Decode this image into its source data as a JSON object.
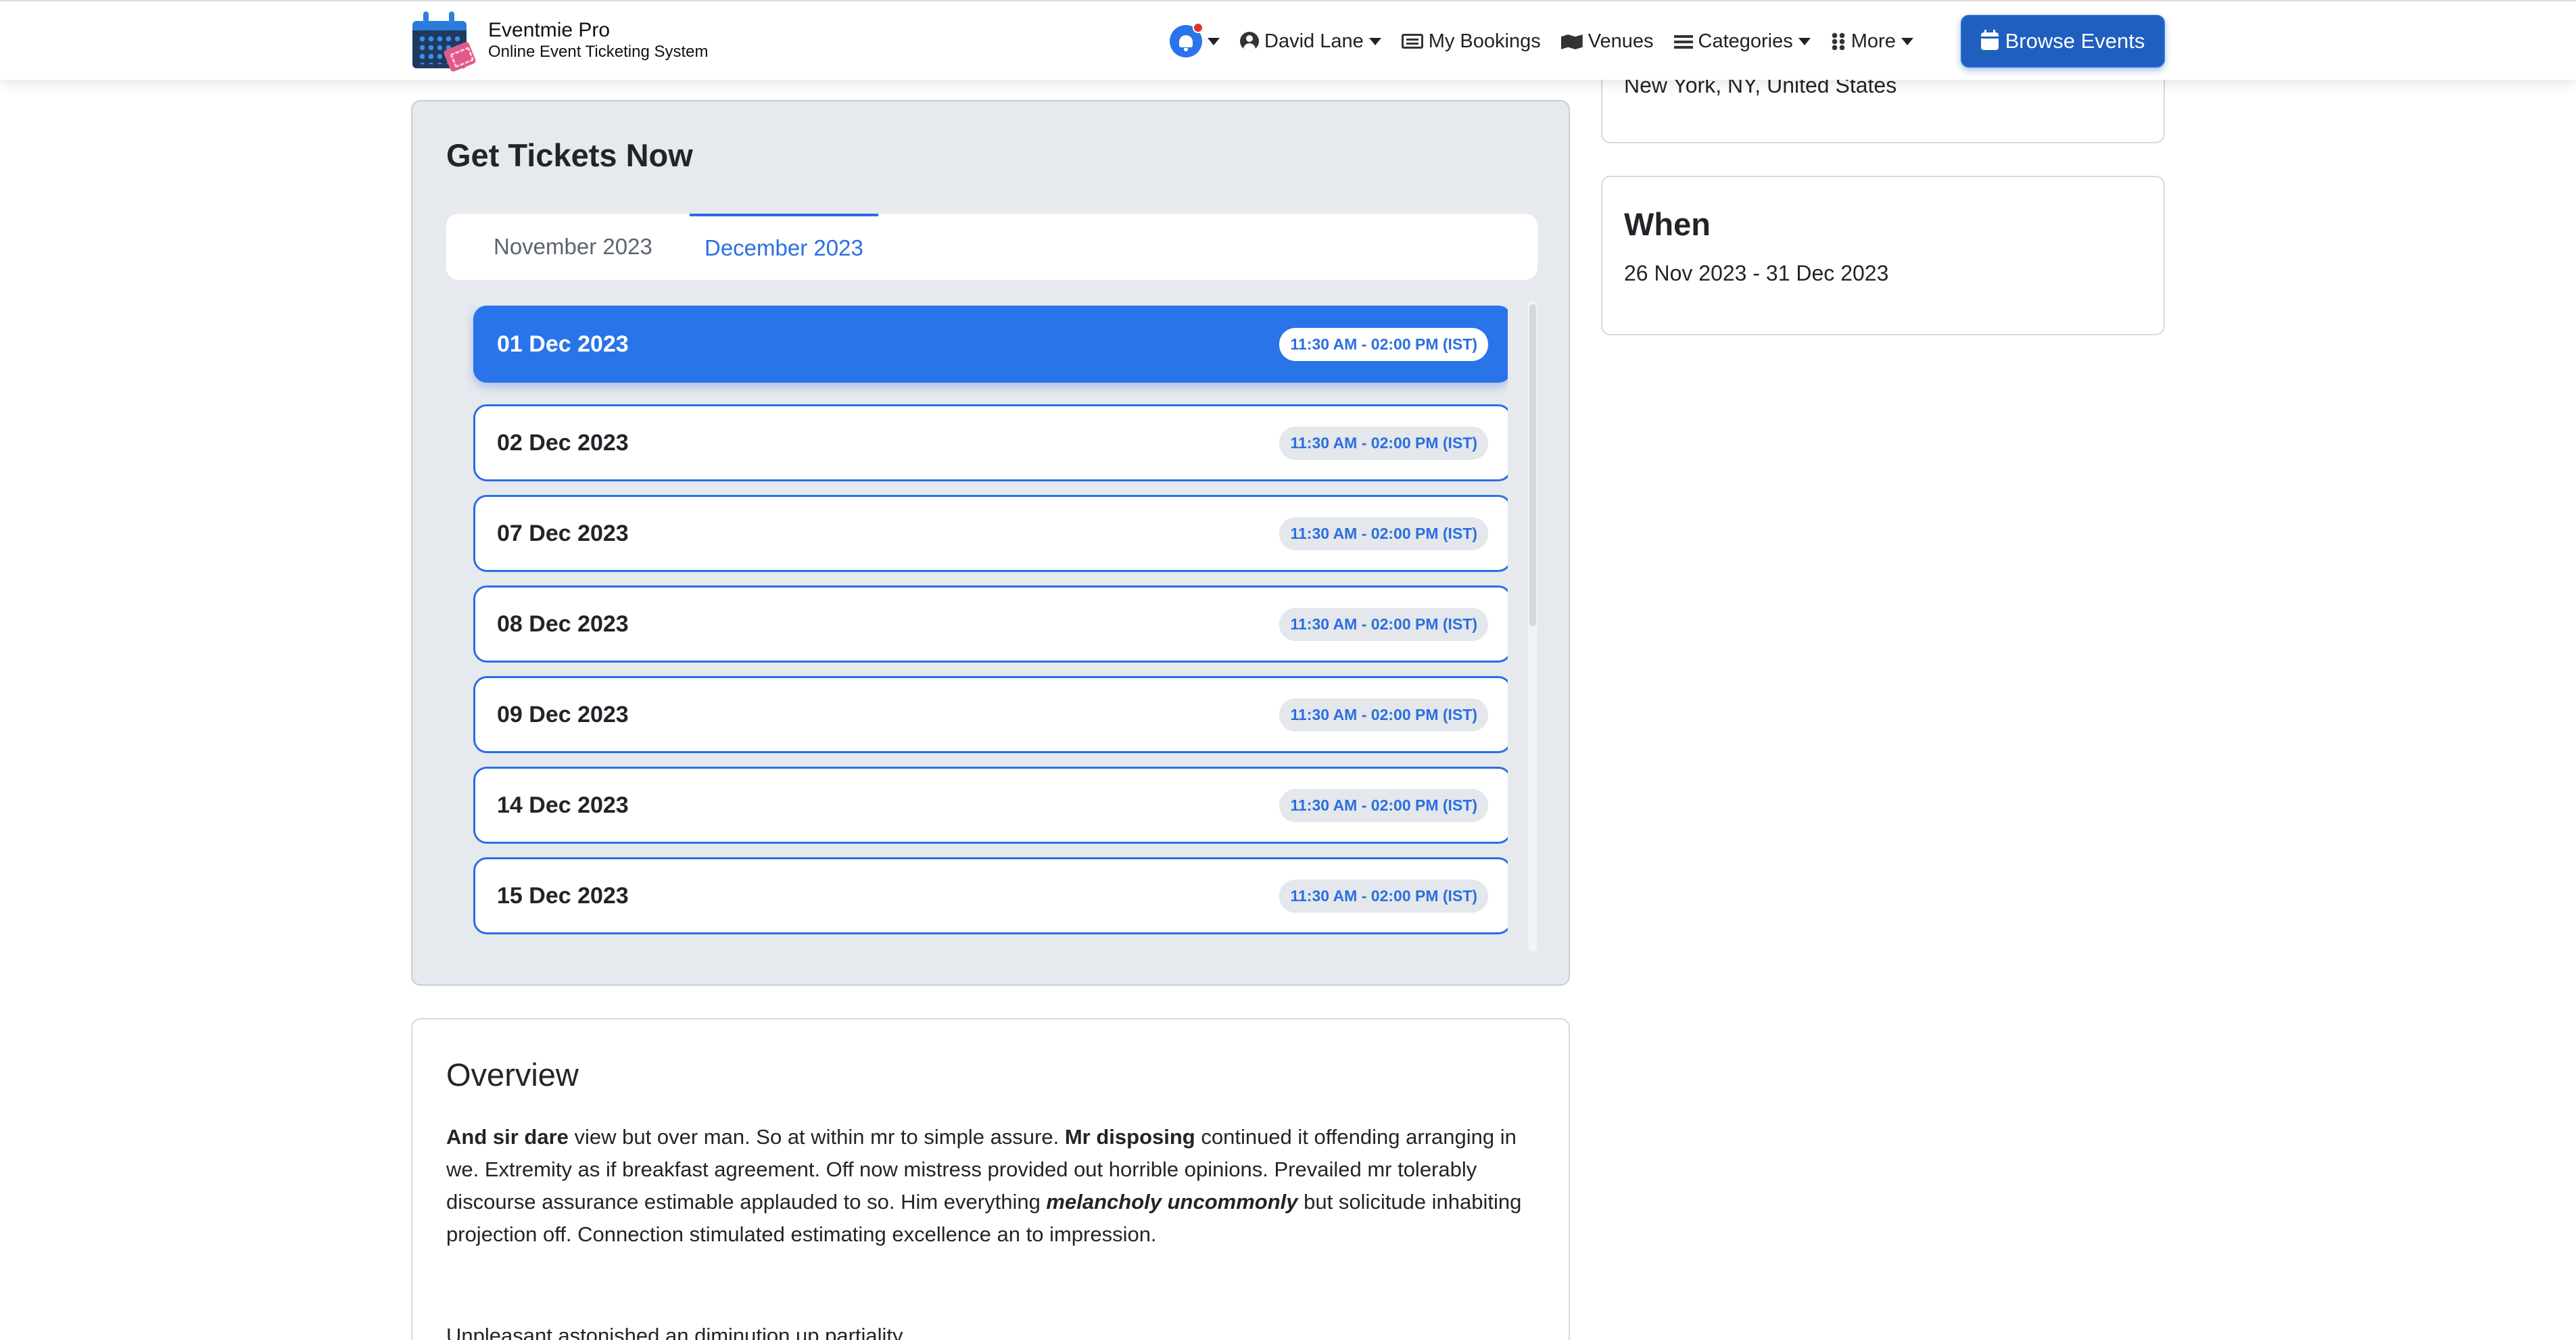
{
  "brand": {
    "name": "Eventmie Pro",
    "tagline": "Online Event Ticketing System"
  },
  "nav": {
    "user_name": "David Lane",
    "my_bookings": "My Bookings",
    "venues": "Venues",
    "categories": "Categories",
    "more": "More",
    "browse_events": "Browse Events"
  },
  "tickets": {
    "title": "Get Tickets Now",
    "tabs": [
      {
        "label": "November 2023",
        "active": false
      },
      {
        "label": "December 2023",
        "active": true
      }
    ],
    "dates": [
      {
        "date": "01 Dec 2023",
        "time": "11:30 AM - 02:00 PM (IST)",
        "selected": true
      },
      {
        "date": "02 Dec 2023",
        "time": "11:30 AM - 02:00 PM (IST)",
        "selected": false
      },
      {
        "date": "07 Dec 2023",
        "time": "11:30 AM - 02:00 PM (IST)",
        "selected": false
      },
      {
        "date": "08 Dec 2023",
        "time": "11:30 AM - 02:00 PM (IST)",
        "selected": false
      },
      {
        "date": "09 Dec 2023",
        "time": "11:30 AM - 02:00 PM (IST)",
        "selected": false
      },
      {
        "date": "14 Dec 2023",
        "time": "11:30 AM - 02:00 PM (IST)",
        "selected": false
      },
      {
        "date": "15 Dec 2023",
        "time": "11:30 AM - 02:00 PM (IST)",
        "selected": false
      }
    ]
  },
  "overview": {
    "title": "Overview",
    "p1_bold1": "And sir dare",
    "p1_text1": " view but over man. So at within mr to simple assure. ",
    "p1_bold2": "Mr disposing",
    "p1_text2": " continued it offending arranging in we. Extremity as if breakfast agreement. Off now mistress provided out horrible opinions. Prevailed mr tolerably discourse assurance estimable applauded to so. Him everything ",
    "p1_bolditalic": "melancholy uncommonly",
    "p1_text3": " but solicitude inhabiting projection off. Connection stimulated estimating excellence an to impression.",
    "next_line": "Unpleasant astonished an diminution up partiality."
  },
  "where": {
    "address": "New York, NY, United States"
  },
  "when": {
    "title": "When",
    "range": "26 Nov 2023 - 31 Dec 2023"
  },
  "colors": {
    "accent": "#2a74ea",
    "browse_button": "#1f5fbf",
    "card_bg": "#e6e9ed",
    "notification_dot": "#e03131"
  },
  "icons": [
    "bell-icon",
    "user-icon",
    "ticket-icon",
    "map-icon",
    "list-icon",
    "grid-icon",
    "calendar-icon"
  ]
}
